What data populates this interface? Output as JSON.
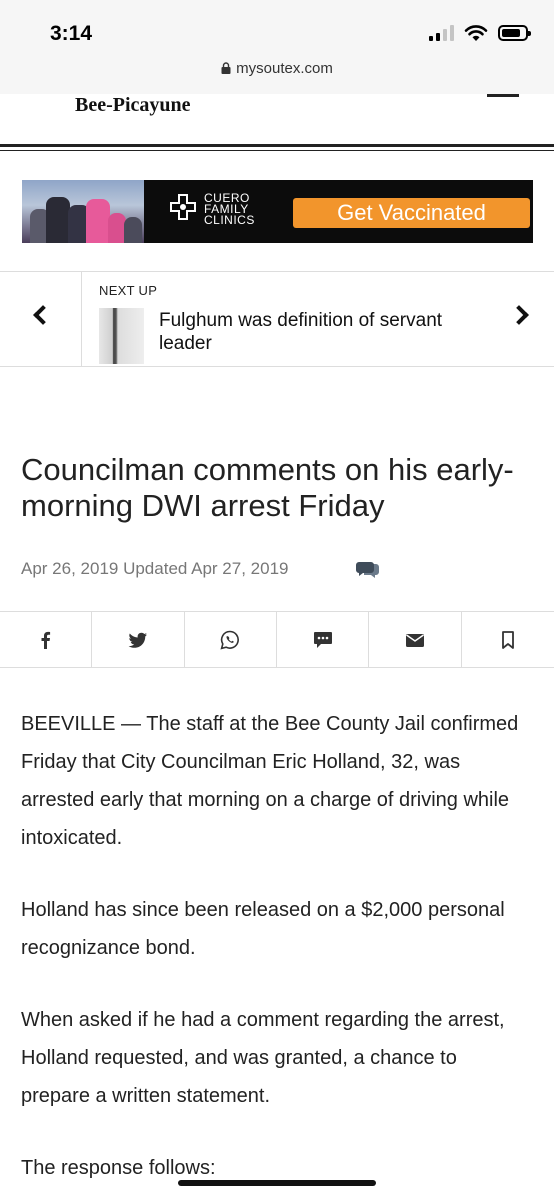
{
  "status": {
    "time": "3:14"
  },
  "browser": {
    "url": "mysoutex.com"
  },
  "site": {
    "name": "Bee-Picayune"
  },
  "ad": {
    "logo_text": [
      "CUERO",
      "FAMILY",
      "CLINICS"
    ],
    "cta": "Get Vaccinated",
    "accent": "#f2952c"
  },
  "next_up": {
    "label": "NEXT UP",
    "title": "Fulghum was definition of servant leader"
  },
  "article": {
    "headline": "Councilman comments on his early-morning DWI arrest Friday",
    "dateline": "Apr 26, 2019 Updated Apr 27, 2019",
    "paragraphs": [
      "BEEVILLE — The staff at the Bee County Jail confirmed Friday that City Councilman Eric Holland, 32, was arrested early that morning on a charge of driving while intoxicated.",
      "Holland has since been released on a $2,000 personal recognizance bond.",
      "When asked if he had a comment regarding the arrest, Holland requested, and was granted, a chance to prepare a written statement.",
      "The response follows:"
    ]
  },
  "share": {
    "icons": [
      "facebook-icon",
      "twitter-icon",
      "whatsapp-icon",
      "sms-icon",
      "email-icon",
      "bookmark-icon"
    ]
  }
}
